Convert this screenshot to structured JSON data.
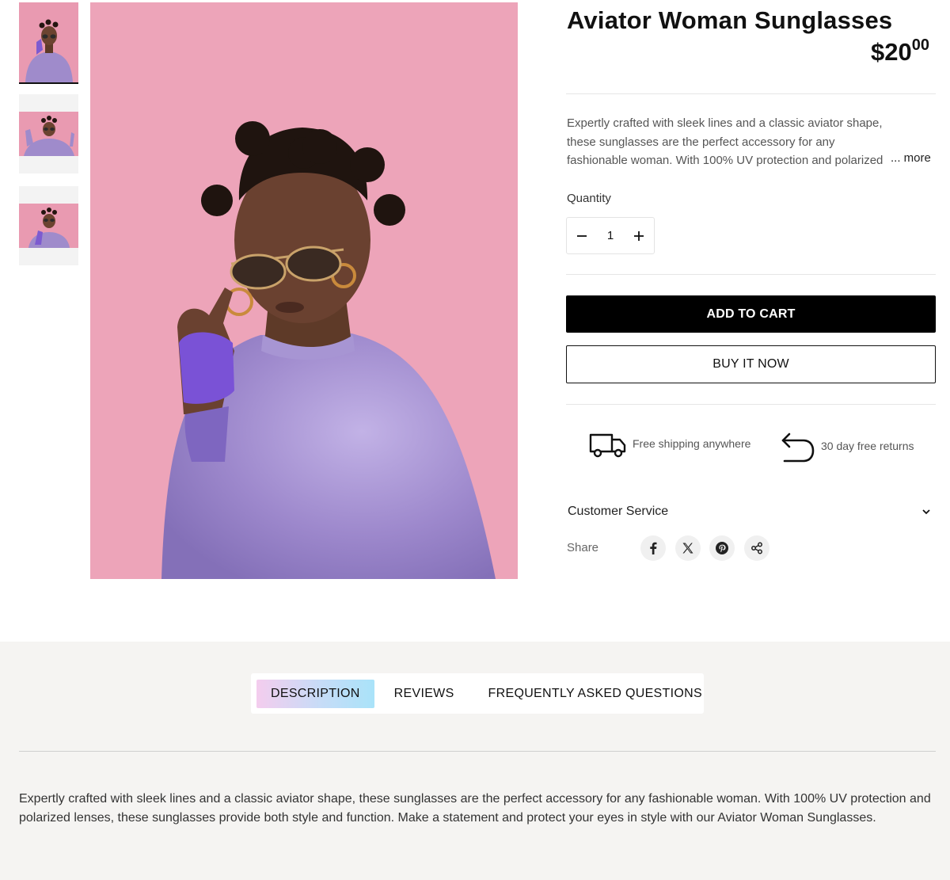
{
  "product": {
    "title": "Aviator Woman Sunglasses",
    "price_main": "$20",
    "price_cents": "00",
    "short_description": "Expertly crafted with sleek lines and a classic aviator shape, these sunglasses are the perfect accessory for any fashionable woman. With 100% UV protection and polarized lenses, these sunglasses provide both style and function.",
    "more_label": "... more"
  },
  "quantity": {
    "label": "Quantity",
    "value": "1",
    "minus": "−",
    "plus": "+"
  },
  "buttons": {
    "add_to_cart": "ADD TO CART",
    "buy_now": "BUY IT NOW"
  },
  "features": {
    "shipping": "Free shipping anywhere",
    "returns": "30 day free returns"
  },
  "customer_service": {
    "label": "Customer Service"
  },
  "share": {
    "label": "Share",
    "icons": [
      "facebook-icon",
      "x-icon",
      "pinterest-icon",
      "share-icon"
    ]
  },
  "gallery": {
    "thumb_count": 3,
    "selected_index": 0,
    "background_color": "#e895ad",
    "outfit_color": "#9c86c9"
  },
  "tabs": [
    {
      "label": "DESCRIPTION",
      "active": true
    },
    {
      "label": "REVIEWS",
      "active": false
    },
    {
      "label": "FREQUENTLY ASKED QUESTIONS",
      "active": false
    }
  ],
  "long_description": "Expertly crafted with sleek lines and a classic aviator shape, these sunglasses are the perfect accessory for any fashionable woman. With 100% UV protection and polarized lenses, these sunglasses provide both style and function. Make a statement and protect your eyes in style with our Aviator Woman Sunglasses.",
  "colors": {
    "primary_button": "#000000",
    "lower_section_bg": "#f5f4f2"
  }
}
